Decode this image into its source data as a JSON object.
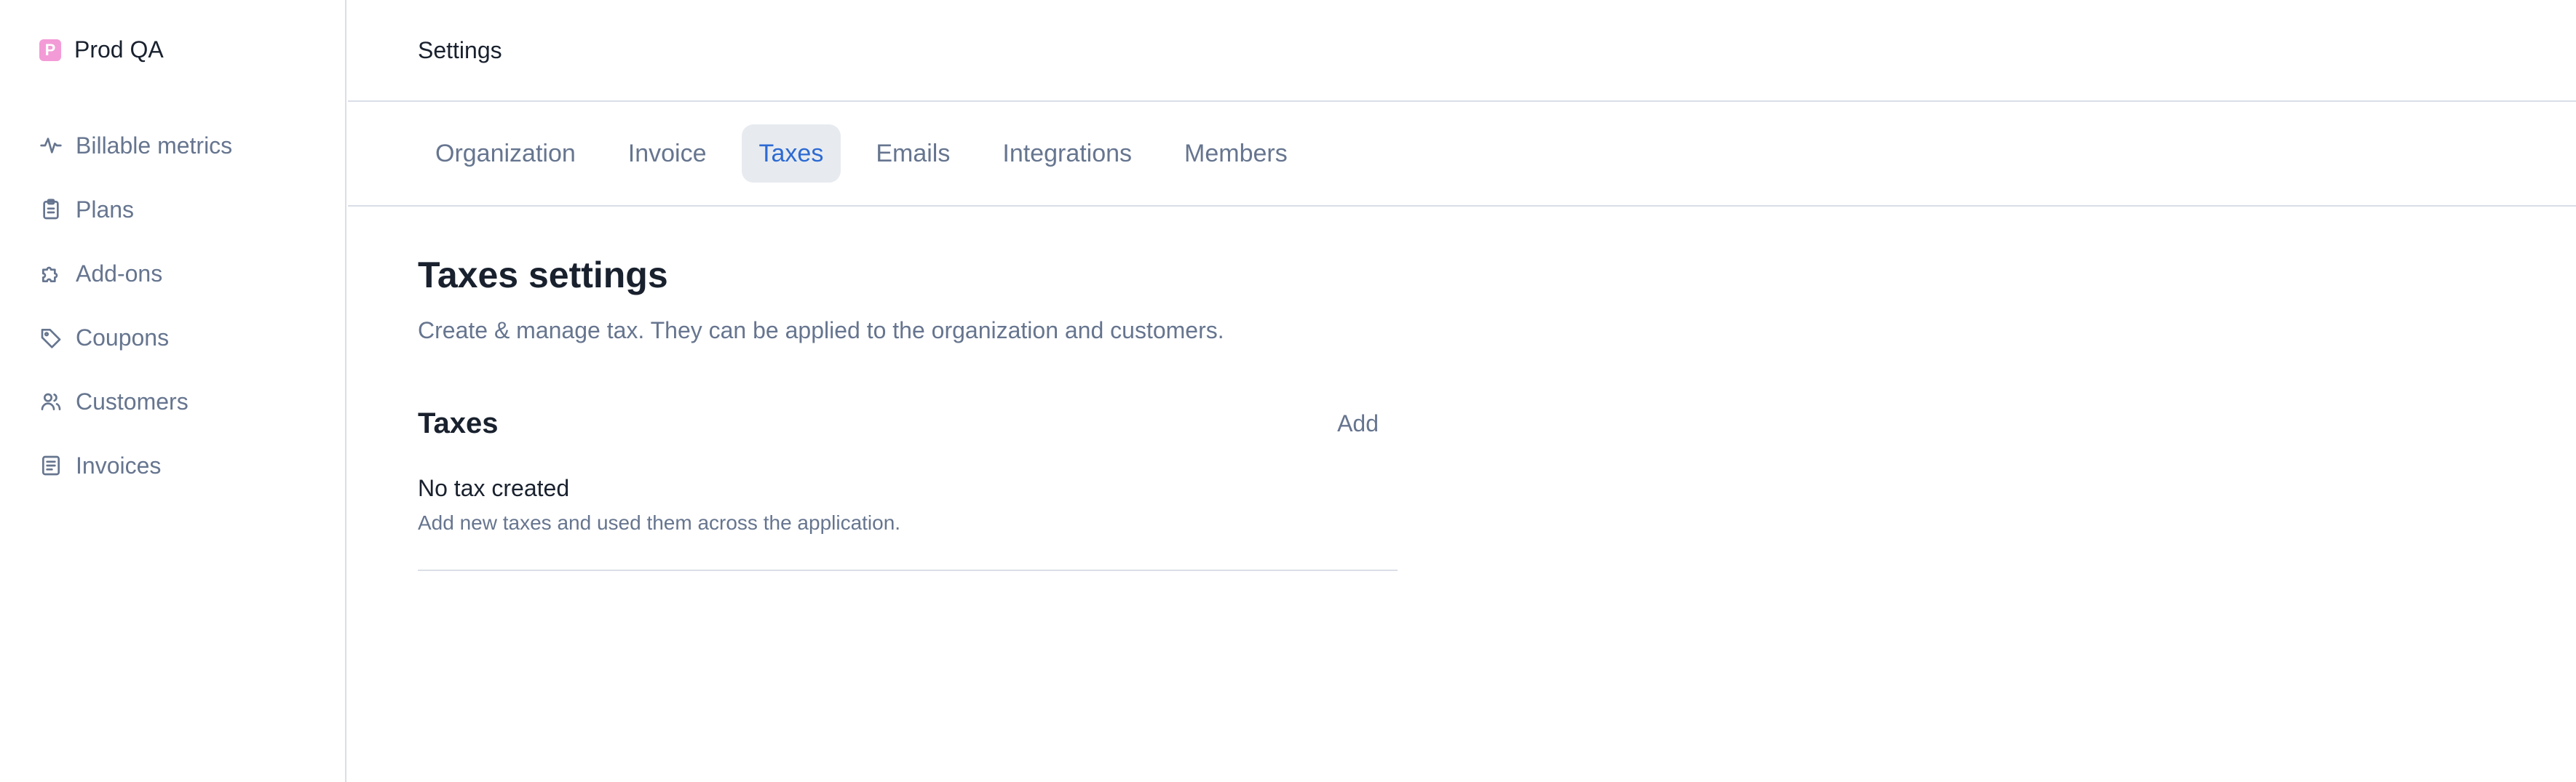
{
  "sidebar": {
    "org": {
      "initial": "P",
      "name": "Prod QA",
      "avatar_color": "#f39bd6"
    },
    "items": [
      {
        "label": "Billable metrics",
        "icon": "pulse-icon"
      },
      {
        "label": "Plans",
        "icon": "clipboard-icon"
      },
      {
        "label": "Add-ons",
        "icon": "puzzle-icon"
      },
      {
        "label": "Coupons",
        "icon": "tag-icon"
      },
      {
        "label": "Customers",
        "icon": "users-icon"
      },
      {
        "label": "Invoices",
        "icon": "document-icon"
      }
    ]
  },
  "header": {
    "title": "Settings"
  },
  "tabs": [
    {
      "label": "Organization",
      "active": false
    },
    {
      "label": "Invoice",
      "active": false
    },
    {
      "label": "Taxes",
      "active": true
    },
    {
      "label": "Emails",
      "active": false
    },
    {
      "label": "Integrations",
      "active": false
    },
    {
      "label": "Members",
      "active": false
    }
  ],
  "main": {
    "title": "Taxes settings",
    "description": "Create & manage tax. They can be applied to the organization and customers.",
    "taxes": {
      "title": "Taxes",
      "add_label": "Add",
      "empty_title": "No tax created",
      "empty_description": "Add new taxes and used them across the application."
    }
  },
  "colors": {
    "accent": "#2d6ad2",
    "muted_text": "#66758f",
    "border": "#d9dee7",
    "active_tab_bg": "#e7ebf0"
  }
}
